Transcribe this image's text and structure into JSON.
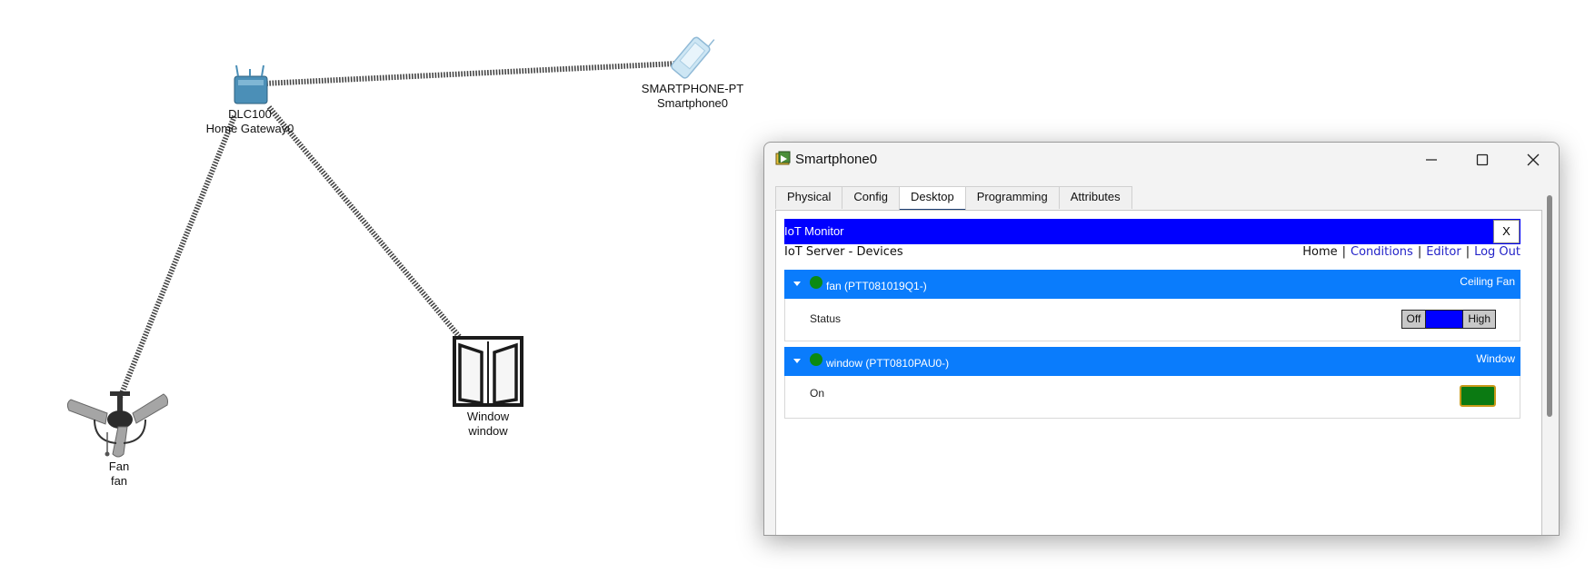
{
  "topology": {
    "gateway": {
      "model": "DLC100",
      "name": "Home Gateway0"
    },
    "smartphone": {
      "model": "SMARTPHONE-PT",
      "name": "Smartphone0"
    },
    "fan": {
      "model": "Fan",
      "name": "fan"
    },
    "window": {
      "model": "Window",
      "name": "window"
    }
  },
  "window": {
    "title": "Smartphone0",
    "controls": {
      "minimize": "minimize-icon",
      "maximize": "maximize-icon",
      "close": "close-icon"
    },
    "tabs": [
      {
        "label": "Physical"
      },
      {
        "label": "Config"
      },
      {
        "label": "Desktop"
      },
      {
        "label": "Programming"
      },
      {
        "label": "Attributes"
      }
    ],
    "active_tab": "Desktop"
  },
  "iot_monitor": {
    "title": "IoT Monitor",
    "close_label": "X",
    "server_title": "IoT Server - Devices",
    "nav": {
      "home": "Home",
      "conditions": "Conditions",
      "editor": "Editor",
      "logout": "Log Out",
      "separator": "|"
    },
    "devices": [
      {
        "name": "fan (PTT081019Q1-)",
        "type": "Ceiling Fan",
        "status_color": "#0b8a12",
        "property": "Status",
        "control": {
          "off_label": "Off",
          "high_label": "High",
          "selected": "low"
        }
      },
      {
        "name": "window (PTT0810PAU0-)",
        "type": "Window",
        "status_color": "#0b8a12",
        "property": "On",
        "indicator_color": "#0b7a12"
      }
    ]
  },
  "colors": {
    "header_blue": "#0000ff",
    "device_header": "#0a7cfc",
    "tab_underline": "#1c3f73"
  }
}
